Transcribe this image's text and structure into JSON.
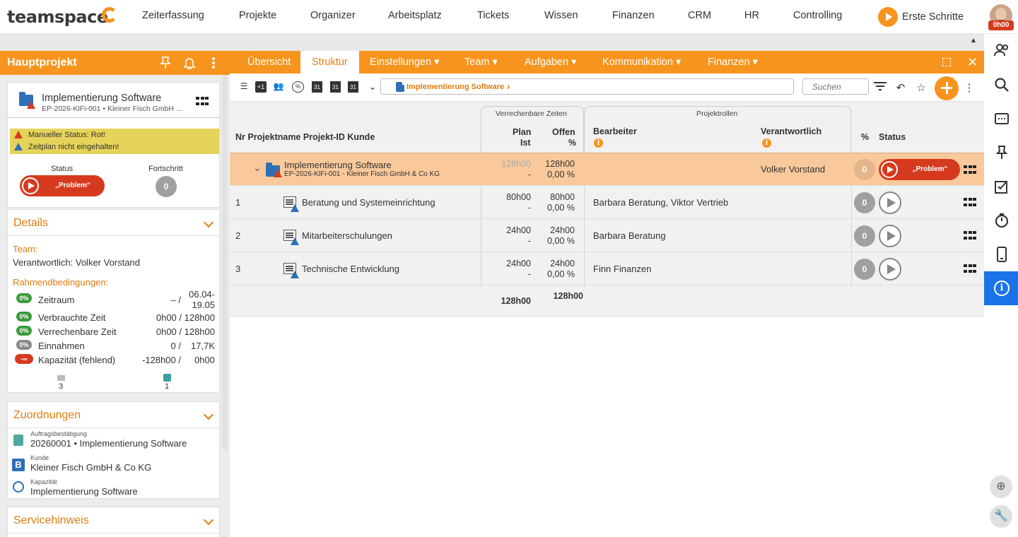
{
  "topnav": {
    "logo": "teamspace",
    "items": [
      "Zeiterfassung",
      "Projekte",
      "Organizer",
      "Arbeitsplatz",
      "Tickets",
      "Wissen",
      "Finanzen",
      "CRM",
      "HR",
      "Controlling"
    ],
    "erste_schritte": "Erste Schritte",
    "avatar_badge": "0h00"
  },
  "left": {
    "header": "Hauptprojekt",
    "project_title": "Implementierung Software",
    "project_sub": "EP-2026-KlFi-001 • Kleiner Fisch GmbH ...",
    "alerts": [
      "Manueller Status: Rot!",
      "Zeitplan nicht eingehalten!"
    ],
    "status_label": "Status",
    "progress_label": "Fortschritt",
    "status_value": "„Problem“",
    "progress_value": "0",
    "details": {
      "title": "Details",
      "team_label": "Team:",
      "responsible": "Verantwortlich: Volker Vorstand",
      "conditions_label": "Rahmendbedingungen:",
      "rows": [
        {
          "badge": "0%",
          "color": "#3a9a3a",
          "label": "Zeitraum",
          "val1": "– /",
          "val2": "06.04-",
          "val3": "19.05"
        },
        {
          "badge": "0%",
          "color": "#3a9a3a",
          "label": "Verbrauchte Zeit",
          "val1": "0h00 / 128h00"
        },
        {
          "badge": "0%",
          "color": "#3a9a3a",
          "label": "Verrechenbare Zeit",
          "val1": "0h00 / 128h00"
        },
        {
          "badge": "0%",
          "color": "#888888",
          "label": "Einnahmen",
          "val1": "0 /",
          "val2": "17,7K"
        },
        {
          "badge": "-∞",
          "color": "#d63a1e",
          "label": "Kapazität (fehlend)",
          "val1": "-128h00 /",
          "val2": "0h00"
        }
      ],
      "count_tasks": "3",
      "count_people": "1"
    },
    "zuordnungen": {
      "title": "Zuordnungen",
      "items": [
        {
          "small": "Auftragsbestätigung",
          "main": "20260001 • Implementierung Software"
        },
        {
          "small": "Kunde",
          "main": "Kleiner Fisch GmbH & Co KG"
        },
        {
          "small": "Kapazität",
          "main": "Implementierung Software"
        }
      ]
    },
    "servicehinweis": {
      "title": "Servicehinweis"
    }
  },
  "tabs": [
    {
      "label": "Übersicht"
    },
    {
      "label": "Struktur"
    },
    {
      "label": "Einstellungen ▾"
    },
    {
      "label": "Team ▾"
    },
    {
      "label": "Aufgaben ▾"
    },
    {
      "label": "Kommunikation ▾"
    },
    {
      "label": "Finanzen ▾"
    }
  ],
  "toolbar": {
    "breadcrumb": "Implementierung Software",
    "search_placeholder": "Suchen"
  },
  "table": {
    "group_times": "Verrechenbare Zeiten",
    "group_roles": "Projektrollen",
    "col_main": "Nr Projektname Projekt-ID Kunde",
    "col_plan": "Plan",
    "col_ist": "Ist",
    "col_offen": "Offen",
    "col_pct_small": "%",
    "col_bearbeiter": "Bearbeiter",
    "col_verantwortlich": "Verantwortlich",
    "col_pct": "%",
    "col_status": "Status",
    "parent": {
      "name": "Implementierung Software",
      "sub": "EP-2026-KlFi-001 - Kleiner Fisch GmbH & Co KG",
      "plan": "128h00",
      "ist": "-",
      "offen": "128h00",
      "offen_pct": "0,00 %",
      "verantwortlich": "Volker Vorstand",
      "pct": "0",
      "status": "„Problem“"
    },
    "rows": [
      {
        "nr": "1",
        "name": "Beratung und Systemeinrichtung",
        "plan": "80h00",
        "ist": "-",
        "offen": "80h00",
        "offen_pct": "0,00 %",
        "bearbeiter": "Barbara Beratung, Viktor Vertrieb",
        "pct": "0"
      },
      {
        "nr": "2",
        "name": "Mitarbeiterschulungen",
        "plan": "24h00",
        "ist": "-",
        "offen": "24h00",
        "offen_pct": "0,00 %",
        "bearbeiter": "Barbara Beratung",
        "pct": "0"
      },
      {
        "nr": "3",
        "name": "Technische Entwicklung",
        "plan": "24h00",
        "ist": "-",
        "offen": "24h00",
        "offen_pct": "0,00 %",
        "bearbeiter": "Finn Finanzen",
        "pct": "0"
      }
    ],
    "total_plan": "128h00",
    "total_offen": "128h00"
  }
}
